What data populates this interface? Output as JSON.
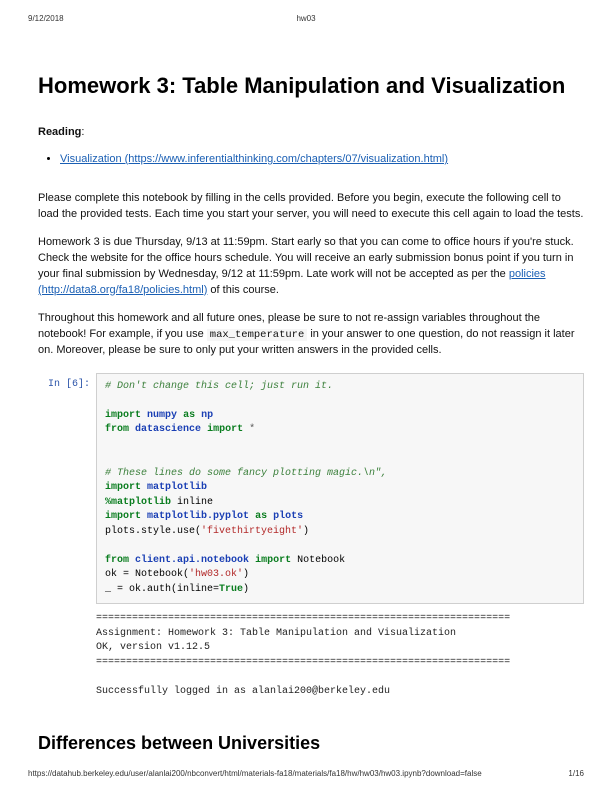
{
  "header": {
    "date": "9/12/2018",
    "title": "hw03"
  },
  "doc": {
    "h1": "Homework 3: Table Manipulation and Visualization",
    "reading_label": "Reading",
    "reading_colon": ":",
    "reading_link_text": "Visualization (https://www.inferentialthinking.com/chapters/07/visualization.html)",
    "p1": "Please complete this notebook by filling in the cells provided. Before you begin, execute the following cell to load the provided tests. Each time you start your server, you will need to execute this cell again to load the tests.",
    "p2a": "Homework 3 is due Thursday, 9/13 at 11:59pm. Start early so that you can come to office hours if you're stuck. Check the website for the office hours schedule. You will receive an early submission bonus point if you turn in your final submission by Wednesday, 9/12 at 11:59pm. Late work will not be accepted as per the ",
    "p2_link_text": "policies (http://data8.org/fa18/policies.html)",
    "p2b": " of this course.",
    "p3a": "Throughout this homework and all future ones, please be sure to not re-assign variables throughout the notebook! For example, if you use ",
    "p3_code": "max_temperature",
    "p3b": " in your answer to one question, do not reassign it later on. Moreover, please be sure to only put your written answers in the provided cells.",
    "h2": "Differences between Universities"
  },
  "cell": {
    "prompt": "In [6]:",
    "code": {
      "l1": "# Don't change this cell; just run it.",
      "l2_import": "import",
      "l2_numpy": "numpy",
      "l2_as": "as",
      "l2_np": "np",
      "l3_from": "from",
      "l3_ds": "datascience",
      "l3_import": "import",
      "l3_star": "*",
      "l4": "# These lines do some fancy plotting magic.\\n\",",
      "l5_import": "import",
      "l5_mpl": "matplotlib",
      "l6_magic": "%",
      "l6_magic2": "matplotlib",
      "l6_inline": " inline",
      "l7_import": "import",
      "l7_mplpp": "matplotlib.pyplot",
      "l7_as": "as",
      "l7_plots": "plots",
      "l8_a": "plots.style.use(",
      "l8_str": "'fivethirtyeight'",
      "l8_b": ")",
      "l9_from": "from",
      "l9_mod": "client.api.notebook",
      "l9_import": "import",
      "l9_nb": " Notebook",
      "l10_a": "ok = Notebook(",
      "l10_str": "'hw03.ok'",
      "l10_b": ")",
      "l11_a": "_ = ok.auth(inline=",
      "l11_true": "True",
      "l11_b": ")"
    },
    "output": "=====================================================================\nAssignment: Homework 3: Table Manipulation and Visualization\nOK, version v1.12.5\n=====================================================================\n\nSuccessfully logged in as alanlai200@berkeley.edu"
  },
  "footer": {
    "url": "https://datahub.berkeley.edu/user/alanlai200/nbconvert/html/materials-fa18/materials/fa18/hw/hw03/hw03.ipynb?download=false",
    "page": "1/16"
  }
}
